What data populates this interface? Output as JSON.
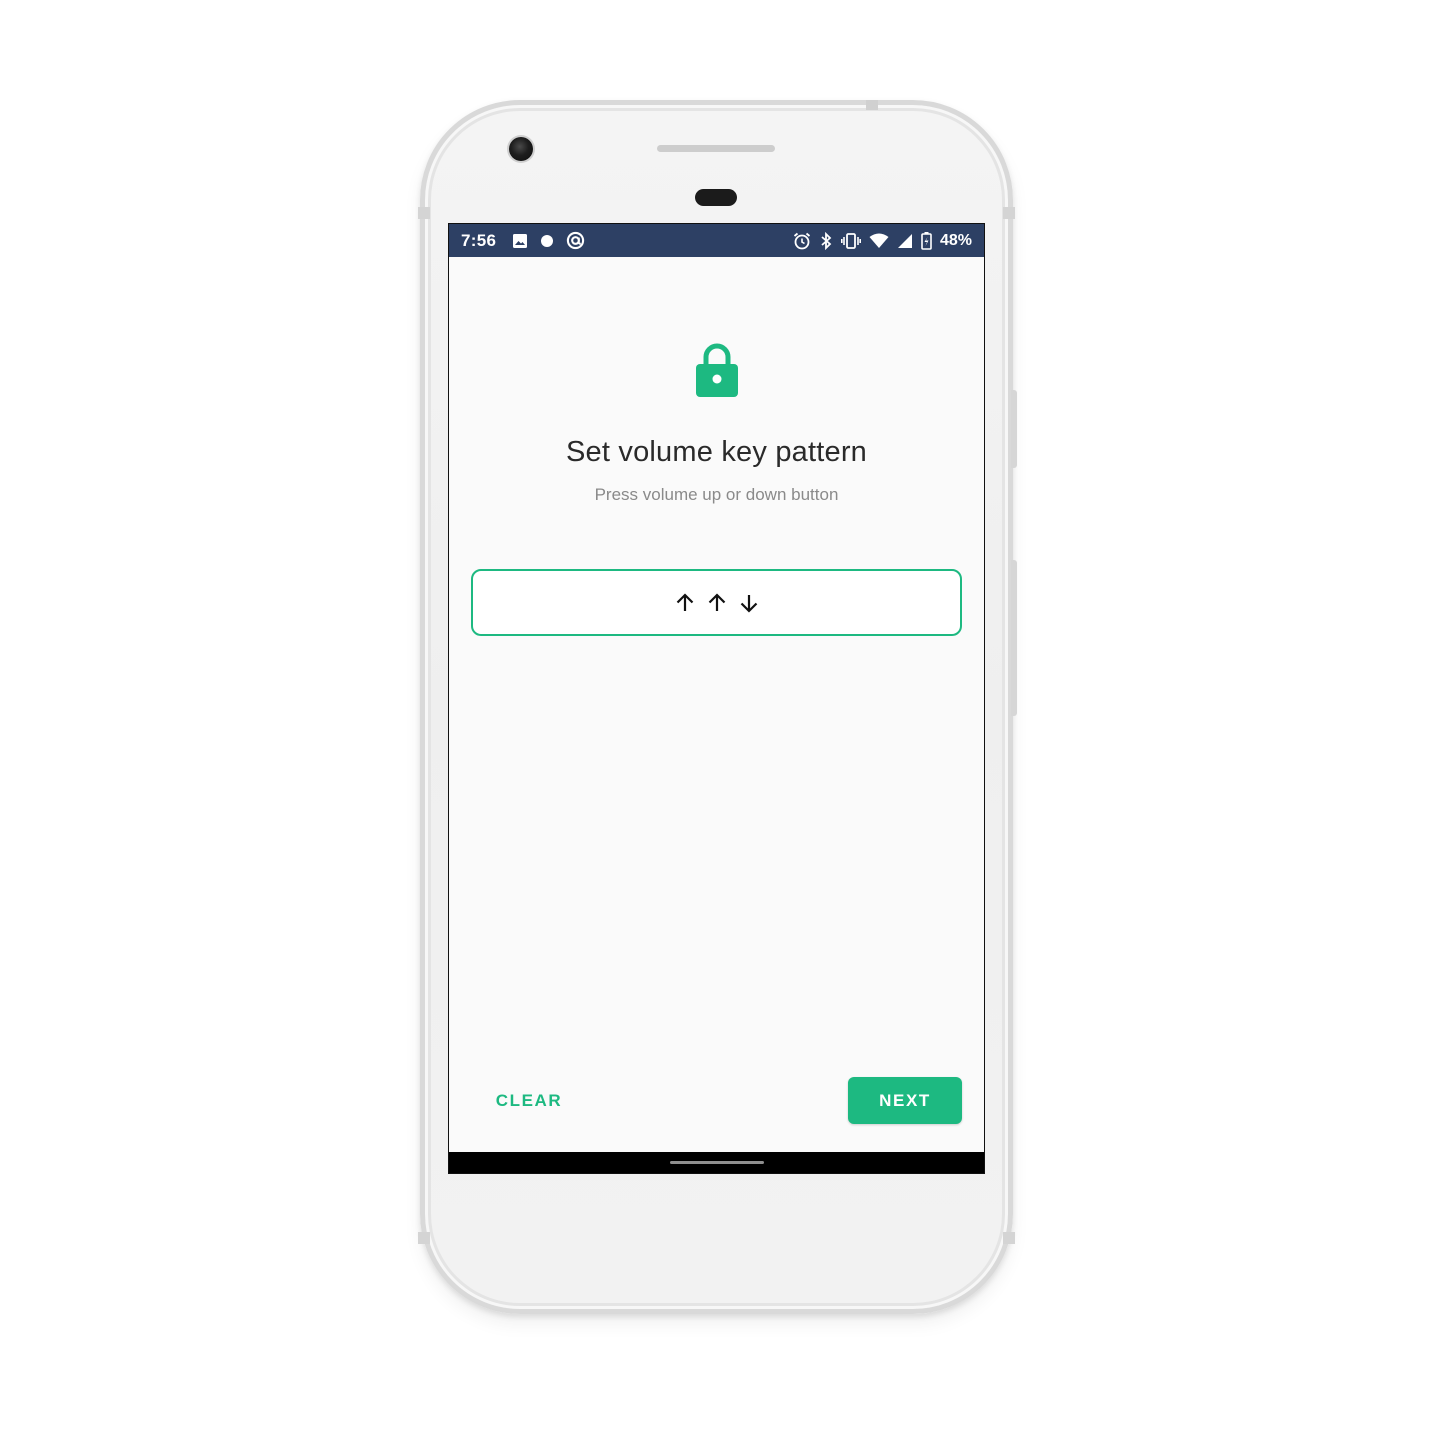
{
  "status_bar": {
    "time": "7:56",
    "left_icons": [
      "image-icon",
      "dot-icon",
      "at-sign-icon"
    ],
    "right_icons": [
      "alarm-icon",
      "bluetooth-icon",
      "vibrate-icon",
      "wifi-icon",
      "signal-icon",
      "battery-icon"
    ],
    "battery_percent": "48%",
    "background_color": "#2d4064"
  },
  "screen": {
    "title": "Set volume key pattern",
    "subtitle": "Press volume up or down button",
    "pattern": [
      "up",
      "up",
      "down"
    ],
    "accent_color": "#1db981"
  },
  "actions": {
    "clear_label": "CLEAR",
    "next_label": "NEXT"
  }
}
